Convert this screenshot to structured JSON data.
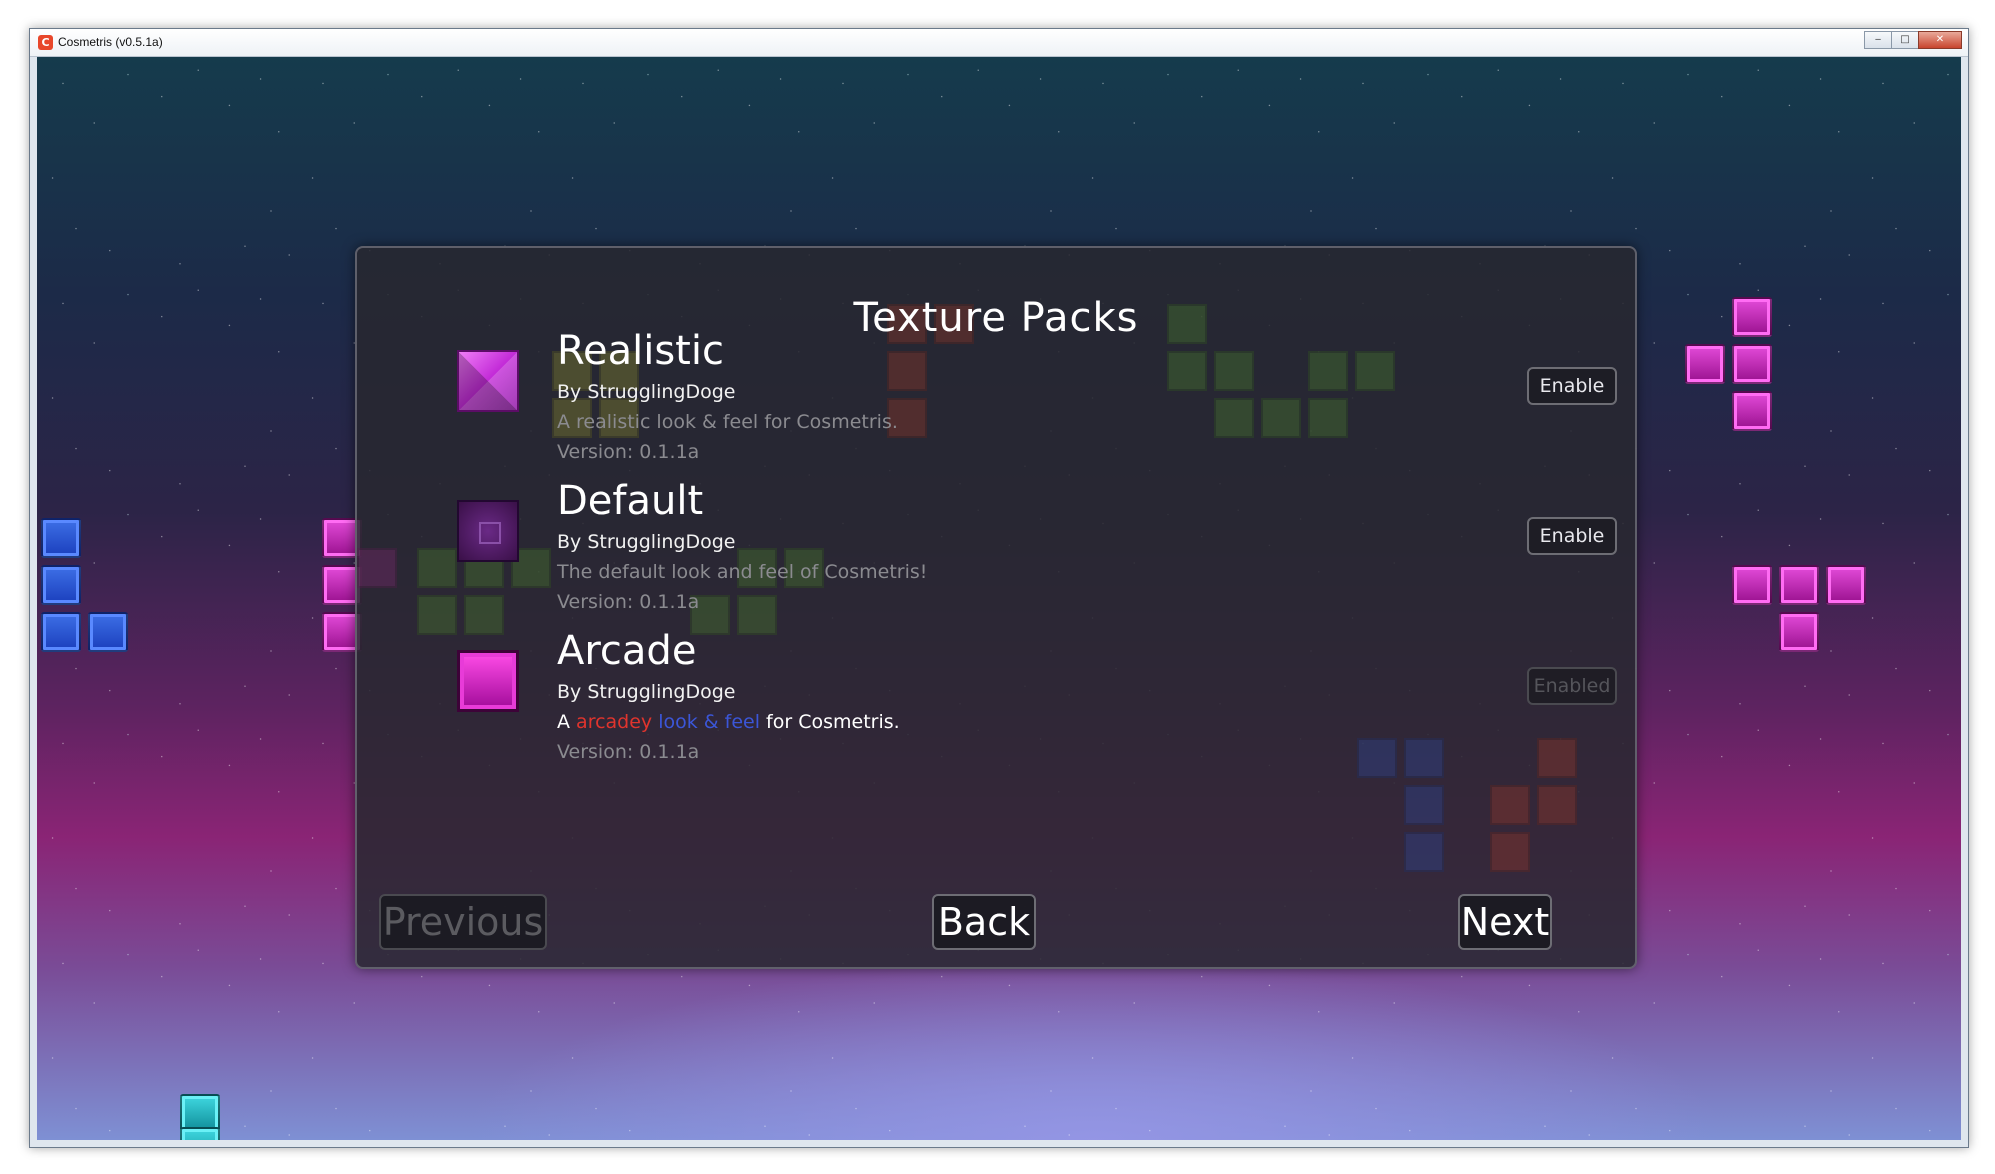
{
  "window": {
    "title": "Cosmetris (v0.5.1a)",
    "icon": "app-logo-icon",
    "controls": [
      "minimize-icon",
      "maximize-icon",
      "close-icon"
    ]
  },
  "screen": {
    "title": "Texture Packs"
  },
  "packs": [
    {
      "name": "Realistic",
      "author": "By StrugglingDoge",
      "description": "A realistic look & feel for Cosmetris.",
      "version": "Version: 0.1.1a",
      "button": "Enable",
      "enabled": false
    },
    {
      "name": "Default",
      "author": "By StrugglingDoge",
      "description": "The default look and feel of Cosmetris!",
      "version": "Version: 0.1.1a",
      "button": "Enable",
      "enabled": false
    },
    {
      "name": "Arcade",
      "author": "By StrugglingDoge",
      "description_parts": {
        "a": "A ",
        "arcadey": "arcadey",
        "space1": " ",
        "lookfeel": "look & feel",
        "rest": " for Cosmetris."
      },
      "version": "Version: 0.1.1a",
      "button": "Enabled",
      "enabled": true
    }
  ],
  "nav": {
    "previous": "Previous",
    "back": "Back",
    "next": "Next"
  },
  "colors": {
    "arcadey": "#e0342d",
    "look_feel": "#3b56d8",
    "panel_bg": "#28282f",
    "disabled_text": "#5b5b60"
  }
}
